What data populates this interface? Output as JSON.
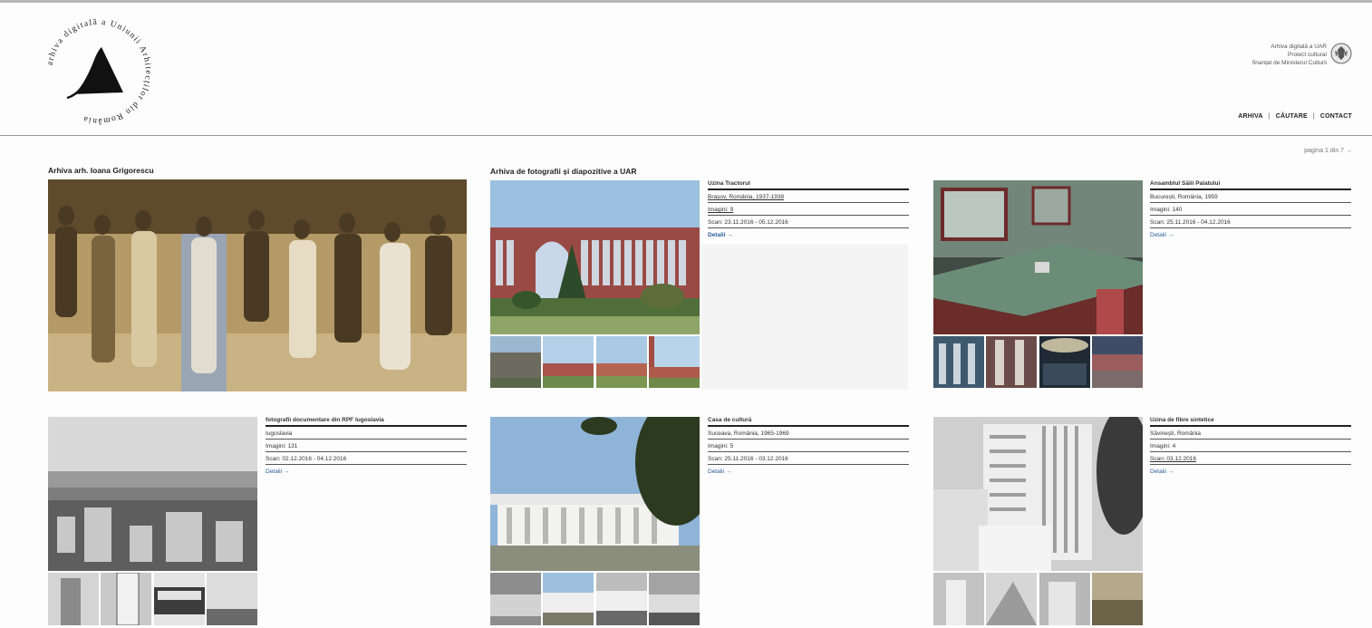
{
  "logo": {
    "ring_text": "arhiva digitală a Uniunii Arhitecților din România"
  },
  "sponsor": {
    "line1": "Arhiva digitală a UAR",
    "line2": "Proiect cultural",
    "line3": "finanțat de Ministerul Culturii"
  },
  "nav": {
    "items": [
      "ARHIVA",
      "CĂUTARE",
      "CONTACT"
    ],
    "separator": "|"
  },
  "pager": {
    "text": "pagina 1 din 7 →"
  },
  "sections": [
    {
      "title": "Arhiva arh. Ioana Grigorescu"
    },
    {
      "title": "Arhiva de fotografii și diapozitive a UAR"
    }
  ],
  "cards": [
    {
      "title": "Uzina Tractorul",
      "location": "Brașov, România, 1937-1938",
      "images": "Imagini: 9",
      "scan": "Scan: 23.11.2016 - 05.12.2016",
      "details": "Detalii →"
    },
    {
      "title": "Ansamblul Sălii Palatului",
      "location": "București, România, 1959",
      "images": "Imagini: 140",
      "scan": "Scan: 25.11.2016 - 04.12.2016",
      "details": "Detalii →"
    },
    {
      "title": "fotografii documentare din RPF Iugoslavia",
      "location": "Iugoslavia",
      "images": "Imagini: 131",
      "scan": "Scan: 02.12.2016 - 04.12.2016",
      "details": "Detalii →"
    },
    {
      "title": "Casa de cultură",
      "location": "Suceava, România, 1965-1969",
      "images": "Imagini: 5",
      "scan": "Scan: 25.11.2016 - 03.12.2016",
      "details": "Detalii →"
    },
    {
      "title": "Uzina de fibre sintetice",
      "location": "Săvinești, România",
      "images": "Imagini: 4",
      "scan": "Scan: 03.12.2016",
      "details": "Detalii →"
    }
  ],
  "colors": {
    "link": "#2b5d9a",
    "rule": "#222222",
    "sepia": "#b49a66",
    "sky": "#8fb4d8"
  }
}
